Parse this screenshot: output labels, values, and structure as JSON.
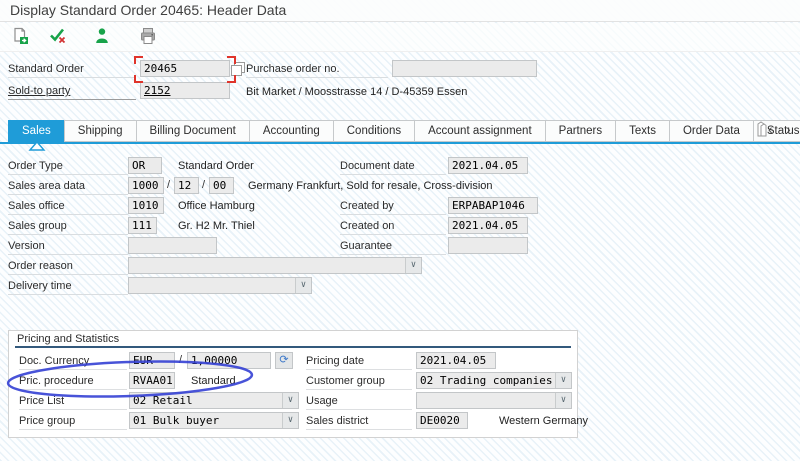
{
  "colors": {
    "accent_blue": "#1f9cd8",
    "group_rule_navy": "#33597c",
    "annotation_red": "#e0342b",
    "annotation_blue": "#3440d4",
    "icon_green": "#18a34a"
  },
  "title_bar": {
    "title": "Display Standard Order 20465: Header Data"
  },
  "toolbar": {
    "buttons": [
      {
        "icon": "document-flow-icon"
      },
      {
        "icon": "status-check-icon"
      },
      {
        "icon": "partner-person-icon"
      },
      {
        "icon": "print-output-icon"
      }
    ]
  },
  "header": {
    "standard_order_label": "Standard Order",
    "standard_order_value": "20465",
    "purchase_order_label": "Purchase order no.",
    "purchase_order_value": "",
    "sold_to_label": "Sold-to party",
    "sold_to_value": "2152",
    "sold_to_address": "Bit Market / Moosstrasse 14 / D-45359 Essen"
  },
  "tabs": {
    "items": [
      "Sales",
      "Shipping",
      "Billing Document",
      "Accounting",
      "Conditions",
      "Account assignment",
      "Partners",
      "Texts",
      "Order Data",
      "Status"
    ],
    "active": "Sales",
    "scroll_left": "‹",
    "scroll_right": "›"
  },
  "form": {
    "order_type": {
      "label": "Order Type",
      "value": "OR",
      "desc": "Standard Order"
    },
    "document_date": {
      "label": "Document date",
      "value": "2021.04.05"
    },
    "sales_area": {
      "label": "Sales area data",
      "v1": "1000",
      "v2": "12",
      "v3": "00",
      "sep": "/",
      "desc": "Germany Frankfurt, Sold for resale, Cross-division"
    },
    "sales_office": {
      "label": "Sales office",
      "value": "1010",
      "desc": "Office Hamburg"
    },
    "created_by": {
      "label": "Created by",
      "value": "ERPABAP1046"
    },
    "sales_group": {
      "label": "Sales group",
      "value": "111",
      "desc": "Gr. H2 Mr. Thiel"
    },
    "created_on": {
      "label": "Created on",
      "value": "2021.04.05"
    },
    "version": {
      "label": "Version",
      "value": ""
    },
    "guarantee": {
      "label": "Guarantee",
      "value": ""
    },
    "order_reason": {
      "label": "Order reason",
      "value": ""
    },
    "delivery_time": {
      "label": "Delivery time",
      "value": ""
    }
  },
  "pricing": {
    "section_title": "Pricing and Statistics",
    "doc_currency": {
      "label": "Doc. Currency",
      "currency": "EUR",
      "sep": "/",
      "rate": "1,00000",
      "refresh_glyph": "⟳"
    },
    "pricing_date": {
      "label": "Pricing date",
      "value": "2021.04.05"
    },
    "pric_procedure": {
      "label": "Pric. procedure",
      "value": "RVAA01",
      "desc": "Standard"
    },
    "customer_group": {
      "label": "Customer group",
      "value": "02 Trading companies"
    },
    "price_list": {
      "label": "Price List",
      "value": "02 Retail"
    },
    "usage": {
      "label": "Usage",
      "value": ""
    },
    "price_group": {
      "label": "Price group",
      "value": "01 Bulk buyer"
    },
    "sales_district": {
      "label": "Sales district",
      "value": "DE0020",
      "desc": "Western Germany"
    }
  },
  "dropdown_glyph": "∨"
}
